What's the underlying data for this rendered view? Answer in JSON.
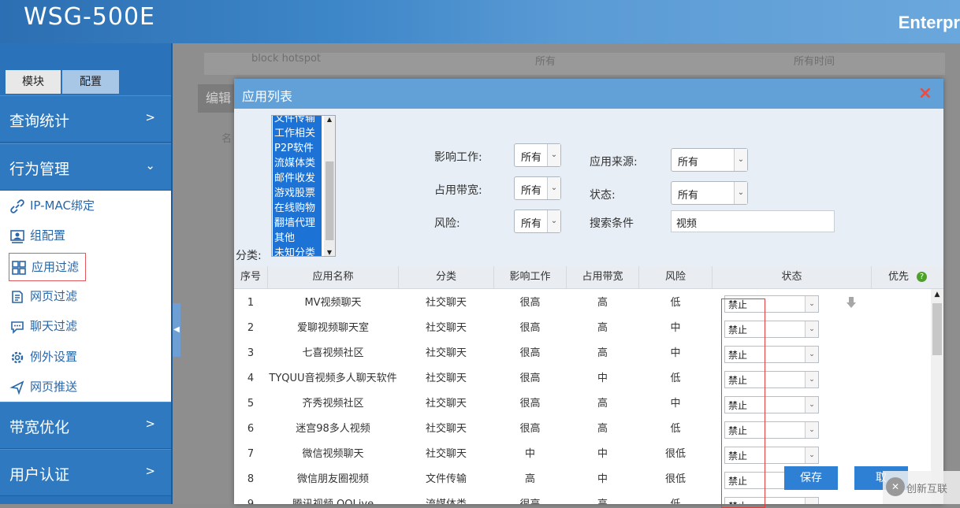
{
  "header": {
    "logo": "WSG-500E",
    "brand": "Enterpr"
  },
  "sidebar": {
    "tabs": [
      "模块",
      "配置"
    ],
    "sections": [
      {
        "label": "查询统计",
        "arrow": ">"
      },
      {
        "label": "行为管理",
        "arrow": "v"
      },
      {
        "label": "带宽优化",
        "arrow": ">"
      },
      {
        "label": "用户认证",
        "arrow": ">"
      }
    ],
    "items": [
      {
        "label": "IP-MAC绑定",
        "icon": "link-icon"
      },
      {
        "label": "组配置",
        "icon": "group-icon"
      },
      {
        "label": "应用过滤",
        "icon": "grid-icon"
      },
      {
        "label": "网页过滤",
        "icon": "page-icon"
      },
      {
        "label": "聊天过滤",
        "icon": "chat-icon"
      },
      {
        "label": "例外设置",
        "icon": "gear-icon"
      },
      {
        "label": "网页推送",
        "icon": "send-icon"
      }
    ]
  },
  "background": {
    "row_text": "block hotspot",
    "col_all": "所有",
    "col_time": "所有时间",
    "edit": "编辑",
    "name": "名"
  },
  "modal": {
    "title": "应用列表",
    "close": "×",
    "category_label": "分类:",
    "categories": [
      "文件传输",
      "工作相关",
      "P2P软件",
      "流媒体类",
      "邮件收发",
      "游戏股票",
      "在线购物",
      "翻墙代理",
      "其他",
      "未知分类"
    ],
    "filters": {
      "work_label": "影响工作:",
      "work_value": "所有",
      "bandwidth_label": "占用带宽:",
      "bandwidth_value": "所有",
      "risk_label": "风险:",
      "risk_value": "所有",
      "source_label": "应用来源:",
      "source_value": "所有",
      "status_label": "状态:",
      "status_value": "所有",
      "search_label": "搜索条件",
      "search_value": "视频"
    },
    "columns": [
      "序号",
      "应用名称",
      "分类",
      "影响工作",
      "占用带宽",
      "风险",
      "状态",
      "优先"
    ],
    "help": "?",
    "rows": [
      [
        "1",
        "MV视频聊天",
        "社交聊天",
        "很高",
        "高",
        "低",
        "禁止"
      ],
      [
        "2",
        "爱聊视频聊天室",
        "社交聊天",
        "很高",
        "高",
        "中",
        "禁止"
      ],
      [
        "3",
        "七喜视频社区",
        "社交聊天",
        "很高",
        "高",
        "中",
        "禁止"
      ],
      [
        "4",
        "TYQUU音视频多人聊天软件",
        "社交聊天",
        "很高",
        "中",
        "低",
        "禁止"
      ],
      [
        "5",
        "齐秀视频社区",
        "社交聊天",
        "很高",
        "高",
        "中",
        "禁止"
      ],
      [
        "6",
        "迷宫98多人视频",
        "社交聊天",
        "很高",
        "高",
        "低",
        "禁止"
      ],
      [
        "7",
        "微信视频聊天",
        "社交聊天",
        "中",
        "中",
        "很低",
        "禁止"
      ],
      [
        "8",
        "微信朋友圈视频",
        "文件传输",
        "高",
        "中",
        "很低",
        "禁止"
      ],
      [
        "9",
        "腾讯视频 QQLive",
        "流媒体类",
        "很高",
        "高",
        "低",
        "禁止"
      ]
    ],
    "save": "保存",
    "cancel": "取"
  },
  "watermark": "创新互联"
}
